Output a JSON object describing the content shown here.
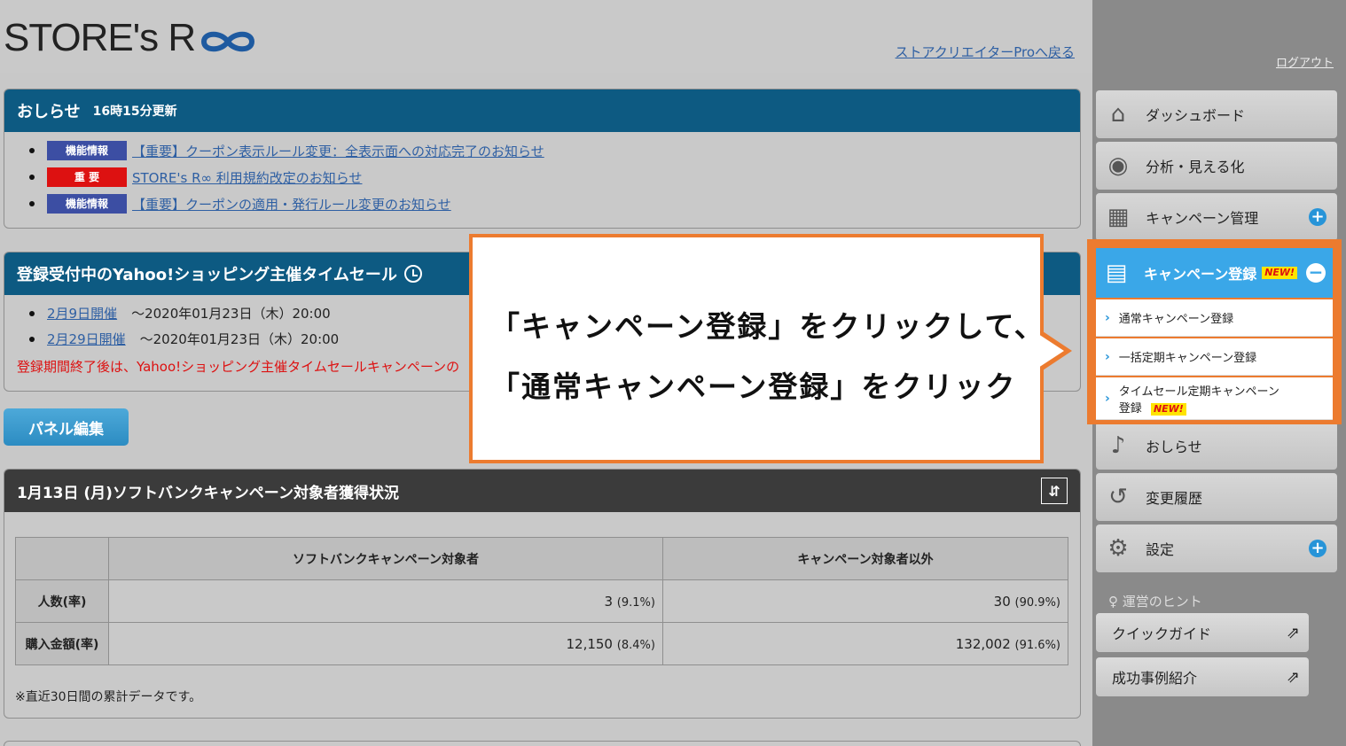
{
  "header": {
    "logo_text": "STORE's R",
    "back_link": "ストアクリエイターProへ戻る"
  },
  "news": {
    "title": "おしらせ",
    "updated": "16時15分更新",
    "items": [
      {
        "tag": "機能情報",
        "tag_color": "#3c4ea3",
        "text": "【重要】クーポン表示ルール変更：全表示面への対応完了のお知らせ"
      },
      {
        "tag": "重 要",
        "tag_color": "#dd1111",
        "text": "STORE's R∞ 利用規約改定のお知らせ"
      },
      {
        "tag": "機能情報",
        "tag_color": "#3c4ea3",
        "text": "【重要】クーポンの適用・発行ルール変更のお知らせ"
      }
    ]
  },
  "timesale": {
    "title": "登録受付中のYahoo!ショッピング主催タイムセール",
    "items": [
      {
        "link": "2月9日開催",
        "deadline": "〜2020年01月23日（木）20:00"
      },
      {
        "link": "2月29日開催",
        "deadline": "〜2020年01月23日（木）20:00"
      }
    ],
    "warning": "登録期間終了後は、Yahoo!ショッピング主催タイムセールキャンペーンの"
  },
  "panel_edit_label": "パネル編集",
  "softbank": {
    "title": "1月13日 (月)ソフトバンクキャンペーン対象者獲得状況",
    "sort_icon": "⇵",
    "columns": [
      "ソフトバンクキャンペーン対象者",
      "キャンペーン対象者以外"
    ],
    "rows": [
      {
        "label": "人数(率)",
        "a": "3",
        "a_rate": "(9.1%)",
        "b": "30",
        "b_rate": "(90.9%)"
      },
      {
        "label": "購入金額(率)",
        "a": "12,150",
        "a_rate": "(8.4%)",
        "b": "132,002",
        "b_rate": "(91.6%)"
      }
    ],
    "note": "※直近30日間の累計データです。"
  },
  "callout": {
    "line1": "「キャンペーン登録」をクリックして、",
    "line2": "「通常キャンペーン登録」をクリック",
    "border_color": "#ec7b2f"
  },
  "sidebar": {
    "logout": "ログアウト",
    "items": [
      {
        "label": "ダッシュボード",
        "icon": "house-icon"
      },
      {
        "label": "分析・見える化",
        "icon": "eye-icon"
      },
      {
        "label": "キャンペーン管理",
        "icon": "calendar-icon"
      },
      {
        "label": "キャンペーン登録",
        "icon": "document-add-icon"
      },
      {
        "label": "おしらせ",
        "icon": "bell-icon"
      },
      {
        "label": "変更履歴",
        "icon": "history-icon"
      },
      {
        "label": "設定",
        "icon": "gear-icon"
      }
    ],
    "new_badge": "NEW!",
    "sub_items": [
      {
        "label": "通常キャンペーン登録"
      },
      {
        "label": "一括定期キャンペーン登録"
      },
      {
        "label": "タイムセール定期キャンペーン",
        "label2": "登録"
      }
    ],
    "hints_title": "運営のヒント",
    "hints": [
      {
        "label": "クイックガイド"
      },
      {
        "label": "成功事例紹介"
      }
    ]
  }
}
